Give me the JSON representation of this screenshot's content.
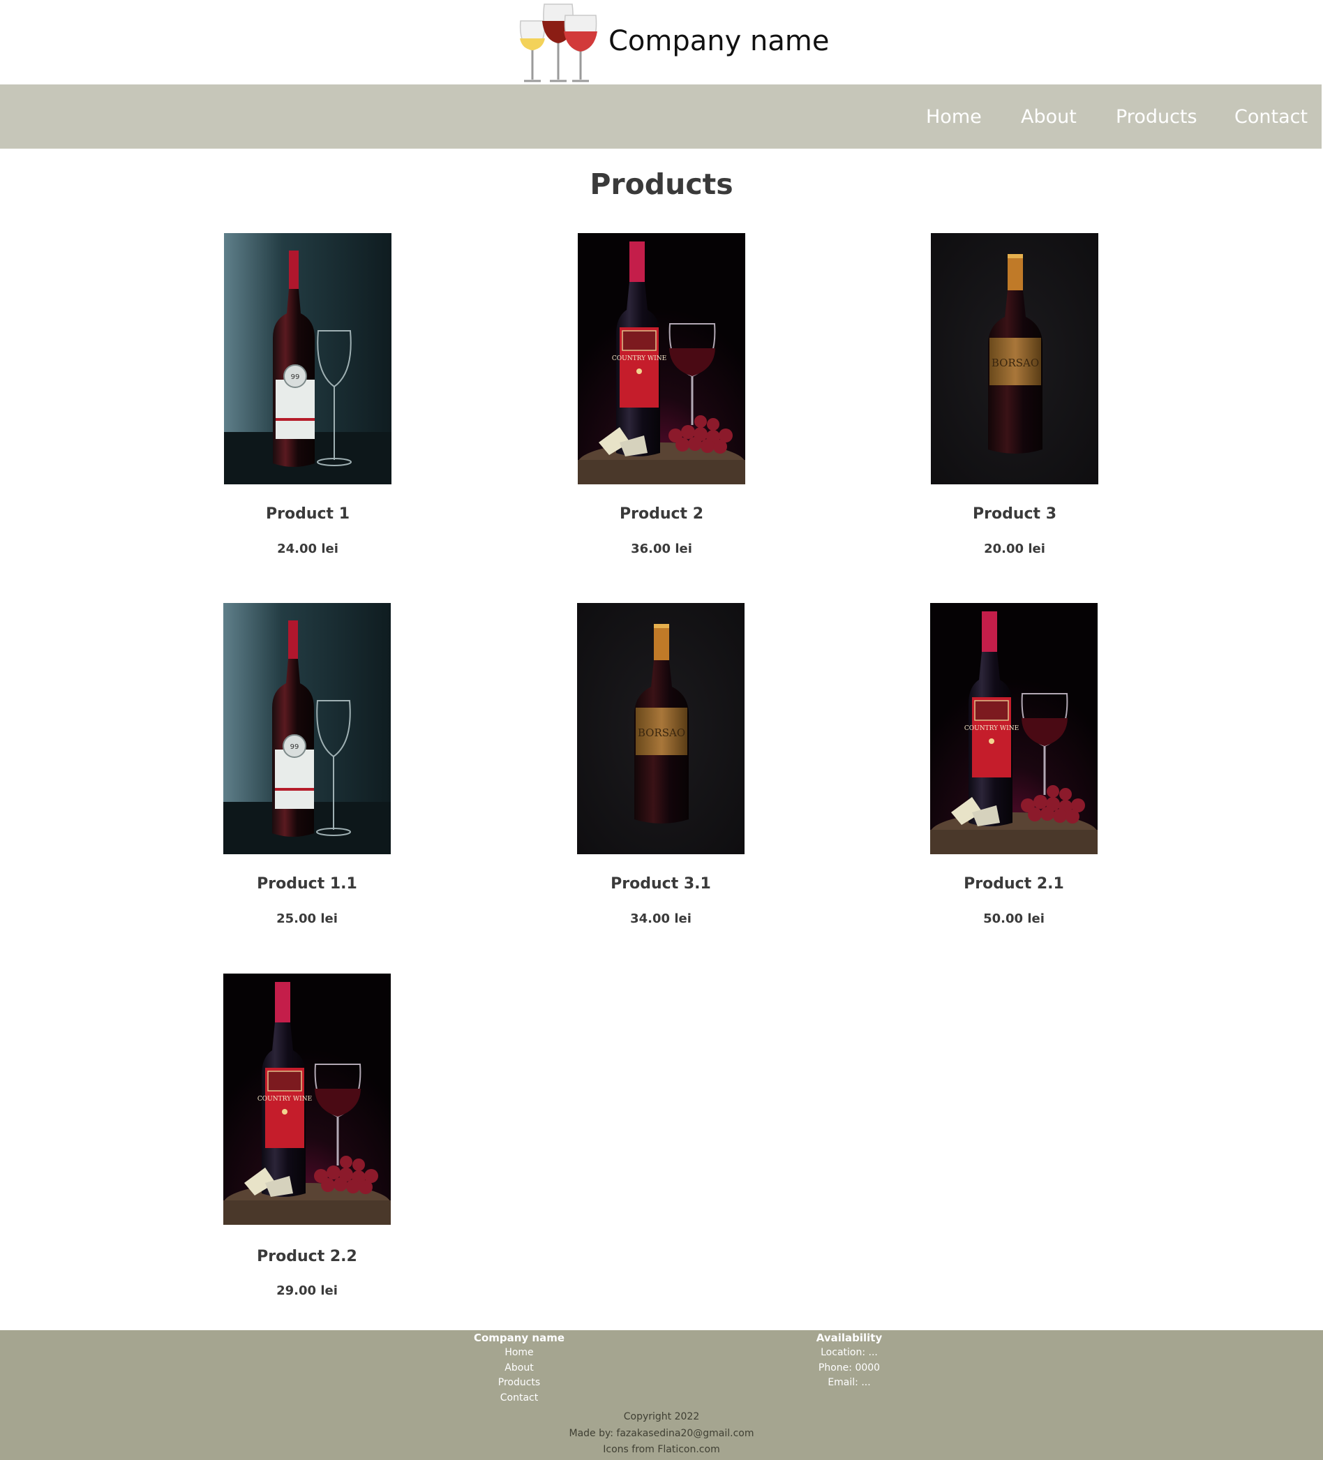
{
  "header": {
    "company_name": "Company name",
    "logo_icon": "wine-glasses-icon"
  },
  "nav": {
    "items": [
      {
        "label": "Home"
      },
      {
        "label": "About"
      },
      {
        "label": "Products"
      },
      {
        "label": "Contact"
      }
    ],
    "bar_color": "#c6c6b9"
  },
  "main": {
    "title": "Products",
    "products": [
      {
        "name": "Product 1",
        "price": "24.00 lei",
        "image": "wine-bottle-white-label-with-glass"
      },
      {
        "name": "Product 2",
        "price": "36.00 lei",
        "image": "wine-bottle-red-label-with-glass-and-grapes"
      },
      {
        "name": "Product 3",
        "price": "20.00 lei",
        "image": "wine-bottle-gold-label"
      },
      {
        "name": "Product 1.1",
        "price": "25.00 lei",
        "image": "wine-bottle-white-label-with-glass"
      },
      {
        "name": "Product 3.1",
        "price": "34.00 lei",
        "image": "wine-bottle-gold-label"
      },
      {
        "name": "Product 2.1",
        "price": "50.00 lei",
        "image": "wine-bottle-red-label-with-glass-and-grapes"
      },
      {
        "name": "Product 2.2",
        "price": "29.00 lei",
        "image": "wine-bottle-red-label-with-glass-and-grapes"
      }
    ]
  },
  "footer": {
    "col1": {
      "heading": "Company name",
      "links": [
        "Home",
        "About",
        "Products",
        "Contact"
      ]
    },
    "col2": {
      "heading": "Availability",
      "lines": [
        "Location: ...",
        "Phone: 0000",
        "Email: ..."
      ]
    },
    "copyright": "Copyright 2022",
    "made_by": "Made by: fazakasedina20@gmail.com",
    "icons_credit": "Icons from Flaticon.com",
    "bg_color": "#a5a590"
  }
}
